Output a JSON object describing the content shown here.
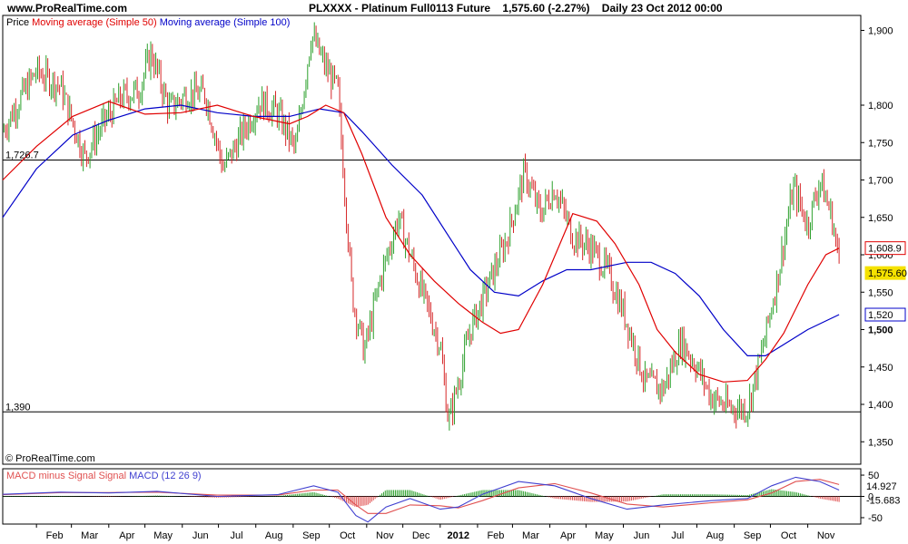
{
  "header": {
    "site": "www.ProRealTime.com",
    "symbol": "PLXXXX - Platinum Full0113 Future",
    "last_change": "1,575.60 (-2.27%)",
    "period_date": "Daily  23 Oct 2012 00:00"
  },
  "colors": {
    "up": "#2ca02c",
    "down": "#d62728",
    "ma50": "#e00000",
    "ma100": "#0000c8",
    "macd": "#4040d0",
    "signal": "#e05050",
    "last_tag": "#f5e200"
  },
  "chart_data": [
    {
      "type": "ohlc-bars",
      "legend": {
        "price": "Price",
        "ma50": "Moving average (Simple 50)",
        "ma100": "Moving average (Simple 100)"
      },
      "ylim": [
        1320,
        1920
      ],
      "y_ticks": [
        {
          "v": 1350,
          "label": "1,350"
        },
        {
          "v": 1400,
          "label": "1,400"
        },
        {
          "v": 1450,
          "label": "1,450"
        },
        {
          "v": 1500,
          "label": "1,500",
          "bold": true
        },
        {
          "v": 1550,
          "label": "1,550"
        },
        {
          "v": 1600,
          "label": "1,600"
        },
        {
          "v": 1650,
          "label": "1,650"
        },
        {
          "v": 1700,
          "label": "1,700"
        },
        {
          "v": 1750,
          "label": "1,750"
        },
        {
          "v": 1800,
          "label": "1,800"
        },
        {
          "v": 1900,
          "label": "1,900"
        }
      ],
      "hlines": [
        {
          "v": 1726.7,
          "label": "1,726.7"
        },
        {
          "v": 1390,
          "label": "1,390"
        }
      ],
      "tags": {
        "last_price": "1,575.60",
        "ma50_value": "1,608.9",
        "ma100_value": "1,520"
      },
      "x_ticks": [
        {
          "day": 0,
          "label": "Feb"
        },
        {
          "day": 29,
          "label": "Mar"
        },
        {
          "day": 60,
          "label": "Apr"
        },
        {
          "day": 90,
          "label": "May"
        },
        {
          "day": 121,
          "label": "Jun"
        },
        {
          "day": 151,
          "label": "Jul"
        },
        {
          "day": 182,
          "label": "Aug"
        },
        {
          "day": 213,
          "label": "Sep"
        },
        {
          "day": 243,
          "label": "Oct"
        },
        {
          "day": 274,
          "label": "Nov"
        },
        {
          "day": 304,
          "label": "Dec"
        },
        {
          "day": 335,
          "label": "2012",
          "bold": true
        },
        {
          "day": 366,
          "label": "Feb"
        },
        {
          "day": 395,
          "label": "Mar"
        },
        {
          "day": 426,
          "label": "Apr"
        },
        {
          "day": 456,
          "label": "May"
        },
        {
          "day": 487,
          "label": "Jun"
        },
        {
          "day": 517,
          "label": "Jul"
        },
        {
          "day": 548,
          "label": "Aug"
        },
        {
          "day": 579,
          "label": "Sep"
        },
        {
          "day": 609,
          "label": "Oct"
        },
        {
          "day": 640,
          "label": "Nov"
        }
      ],
      "close_path": [
        {
          "day": -28,
          "v": 1765
        },
        {
          "day": -15,
          "v": 1805
        },
        {
          "day": 0,
          "v": 1845
        },
        {
          "day": 20,
          "v": 1825
        },
        {
          "day": 40,
          "v": 1730
        },
        {
          "day": 55,
          "v": 1775
        },
        {
          "day": 70,
          "v": 1810
        },
        {
          "day": 85,
          "v": 1820
        },
        {
          "day": 95,
          "v": 1870
        },
        {
          "day": 110,
          "v": 1795
        },
        {
          "day": 125,
          "v": 1815
        },
        {
          "day": 140,
          "v": 1815
        },
        {
          "day": 155,
          "v": 1715
        },
        {
          "day": 170,
          "v": 1760
        },
        {
          "day": 185,
          "v": 1805
        },
        {
          "day": 200,
          "v": 1790
        },
        {
          "day": 215,
          "v": 1740
        },
        {
          "day": 228,
          "v": 1895
        },
        {
          "day": 240,
          "v": 1850
        },
        {
          "day": 250,
          "v": 1820
        },
        {
          "day": 262,
          "v": 1545
        },
        {
          "day": 272,
          "v": 1470
        },
        {
          "day": 285,
          "v": 1565
        },
        {
          "day": 300,
          "v": 1650
        },
        {
          "day": 310,
          "v": 1600
        },
        {
          "day": 320,
          "v": 1550
        },
        {
          "day": 335,
          "v": 1480
        },
        {
          "day": 342,
          "v": 1375
        },
        {
          "day": 350,
          "v": 1430
        },
        {
          "day": 360,
          "v": 1500
        },
        {
          "day": 375,
          "v": 1560
        },
        {
          "day": 390,
          "v": 1620
        },
        {
          "day": 405,
          "v": 1710
        },
        {
          "day": 418,
          "v": 1655
        },
        {
          "day": 430,
          "v": 1690
        },
        {
          "day": 445,
          "v": 1625
        },
        {
          "day": 460,
          "v": 1610
        },
        {
          "day": 475,
          "v": 1575
        },
        {
          "day": 490,
          "v": 1510
        },
        {
          "day": 505,
          "v": 1430
        },
        {
          "day": 520,
          "v": 1420
        },
        {
          "day": 535,
          "v": 1485
        },
        {
          "day": 548,
          "v": 1450
        },
        {
          "day": 560,
          "v": 1410
        },
        {
          "day": 575,
          "v": 1395
        },
        {
          "day": 590,
          "v": 1395
        },
        {
          "day": 602,
          "v": 1470
        },
        {
          "day": 615,
          "v": 1570
        },
        {
          "day": 628,
          "v": 1690
        },
        {
          "day": 640,
          "v": 1640
        },
        {
          "day": 650,
          "v": 1700
        },
        {
          "day": 660,
          "v": 1650
        },
        {
          "day": 666,
          "v": 1590
        }
      ],
      "ma50": [
        {
          "day": -28,
          "v": 1700
        },
        {
          "day": 0,
          "v": 1745
        },
        {
          "day": 30,
          "v": 1785
        },
        {
          "day": 60,
          "v": 1805
        },
        {
          "day": 90,
          "v": 1788
        },
        {
          "day": 120,
          "v": 1790
        },
        {
          "day": 150,
          "v": 1800
        },
        {
          "day": 180,
          "v": 1785
        },
        {
          "day": 210,
          "v": 1775
        },
        {
          "day": 225,
          "v": 1785
        },
        {
          "day": 240,
          "v": 1800
        },
        {
          "day": 255,
          "v": 1790
        },
        {
          "day": 270,
          "v": 1735
        },
        {
          "day": 290,
          "v": 1650
        },
        {
          "day": 310,
          "v": 1600
        },
        {
          "day": 330,
          "v": 1565
        },
        {
          "day": 350,
          "v": 1535
        },
        {
          "day": 370,
          "v": 1510
        },
        {
          "day": 385,
          "v": 1495
        },
        {
          "day": 400,
          "v": 1500
        },
        {
          "day": 420,
          "v": 1560
        },
        {
          "day": 445,
          "v": 1655
        },
        {
          "day": 465,
          "v": 1645
        },
        {
          "day": 480,
          "v": 1615
        },
        {
          "day": 500,
          "v": 1560
        },
        {
          "day": 515,
          "v": 1500
        },
        {
          "day": 530,
          "v": 1470
        },
        {
          "day": 550,
          "v": 1440
        },
        {
          "day": 570,
          "v": 1430
        },
        {
          "day": 590,
          "v": 1432
        },
        {
          "day": 605,
          "v": 1460
        },
        {
          "day": 620,
          "v": 1495
        },
        {
          "day": 640,
          "v": 1560
        },
        {
          "day": 655,
          "v": 1600
        },
        {
          "day": 666,
          "v": 1608.9
        }
      ],
      "ma100": [
        {
          "day": -28,
          "v": 1650
        },
        {
          "day": 0,
          "v": 1715
        },
        {
          "day": 30,
          "v": 1760
        },
        {
          "day": 60,
          "v": 1780
        },
        {
          "day": 90,
          "v": 1795
        },
        {
          "day": 120,
          "v": 1800
        },
        {
          "day": 150,
          "v": 1790
        },
        {
          "day": 180,
          "v": 1785
        },
        {
          "day": 210,
          "v": 1785
        },
        {
          "day": 235,
          "v": 1795
        },
        {
          "day": 255,
          "v": 1790
        },
        {
          "day": 270,
          "v": 1765
        },
        {
          "day": 295,
          "v": 1720
        },
        {
          "day": 320,
          "v": 1680
        },
        {
          "day": 340,
          "v": 1630
        },
        {
          "day": 360,
          "v": 1580
        },
        {
          "day": 380,
          "v": 1550
        },
        {
          "day": 400,
          "v": 1545
        },
        {
          "day": 420,
          "v": 1565
        },
        {
          "day": 440,
          "v": 1580
        },
        {
          "day": 460,
          "v": 1580
        },
        {
          "day": 490,
          "v": 1590
        },
        {
          "day": 510,
          "v": 1590
        },
        {
          "day": 530,
          "v": 1575
        },
        {
          "day": 550,
          "v": 1545
        },
        {
          "day": 570,
          "v": 1500
        },
        {
          "day": 590,
          "v": 1465
        },
        {
          "day": 605,
          "v": 1465
        },
        {
          "day": 620,
          "v": 1480
        },
        {
          "day": 640,
          "v": 1500
        },
        {
          "day": 666,
          "v": 1520
        }
      ]
    },
    {
      "type": "macd",
      "legend": {
        "hist": "MACD minus Signal Signal",
        "macd": "MACD (12 26 9)"
      },
      "ylim": [
        -65,
        65
      ],
      "y_ticks": [
        {
          "v": 50,
          "label": "50"
        },
        {
          "v": 0,
          "label": "0"
        },
        {
          "v": -50,
          "label": "-50"
        }
      ],
      "tags": {
        "macd_value": "14.927",
        "signal_value": "-15.683"
      },
      "macd_path": [
        {
          "day": -28,
          "v": 5
        },
        {
          "day": 20,
          "v": 10
        },
        {
          "day": 60,
          "v": 8
        },
        {
          "day": 100,
          "v": 12
        },
        {
          "day": 150,
          "v": 0
        },
        {
          "day": 200,
          "v": 4
        },
        {
          "day": 230,
          "v": 25
        },
        {
          "day": 250,
          "v": 10
        },
        {
          "day": 265,
          "v": -45
        },
        {
          "day": 275,
          "v": -60
        },
        {
          "day": 290,
          "v": -25
        },
        {
          "day": 310,
          "v": -5
        },
        {
          "day": 335,
          "v": -30
        },
        {
          "day": 350,
          "v": -25
        },
        {
          "day": 370,
          "v": 5
        },
        {
          "day": 400,
          "v": 35
        },
        {
          "day": 430,
          "v": 25
        },
        {
          "day": 460,
          "v": -5
        },
        {
          "day": 490,
          "v": -30
        },
        {
          "day": 520,
          "v": -20
        },
        {
          "day": 560,
          "v": -10
        },
        {
          "day": 590,
          "v": -5
        },
        {
          "day": 610,
          "v": 25
        },
        {
          "day": 630,
          "v": 45
        },
        {
          "day": 650,
          "v": 35
        },
        {
          "day": 666,
          "v": 15
        }
      ],
      "signal_path": [
        {
          "day": -28,
          "v": 4
        },
        {
          "day": 20,
          "v": 9
        },
        {
          "day": 60,
          "v": 9
        },
        {
          "day": 100,
          "v": 10
        },
        {
          "day": 150,
          "v": 3
        },
        {
          "day": 200,
          "v": 3
        },
        {
          "day": 230,
          "v": 15
        },
        {
          "day": 250,
          "v": 15
        },
        {
          "day": 265,
          "v": -20
        },
        {
          "day": 275,
          "v": -40
        },
        {
          "day": 290,
          "v": -40
        },
        {
          "day": 310,
          "v": -20
        },
        {
          "day": 335,
          "v": -22
        },
        {
          "day": 350,
          "v": -27
        },
        {
          "day": 370,
          "v": -10
        },
        {
          "day": 400,
          "v": 20
        },
        {
          "day": 430,
          "v": 30
        },
        {
          "day": 460,
          "v": 8
        },
        {
          "day": 490,
          "v": -18
        },
        {
          "day": 520,
          "v": -25
        },
        {
          "day": 560,
          "v": -15
        },
        {
          "day": 590,
          "v": -8
        },
        {
          "day": 610,
          "v": 8
        },
        {
          "day": 630,
          "v": 35
        },
        {
          "day": 650,
          "v": 40
        },
        {
          "day": 666,
          "v": 28
        }
      ]
    }
  ],
  "watermark": "© ProRealTime.com"
}
